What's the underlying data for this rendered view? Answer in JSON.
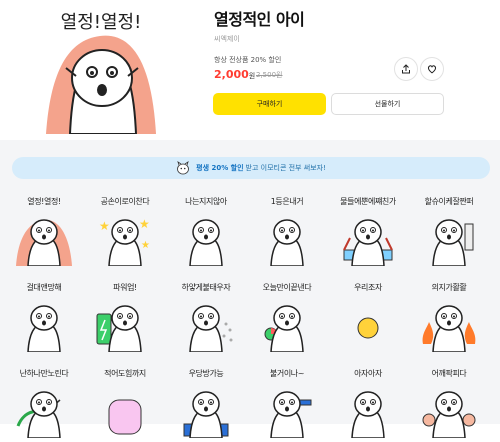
{
  "product": {
    "title": "열정적인 아이",
    "author": "씨엑제이",
    "promo": "항상 전상품 20% 할인",
    "price": "2,000",
    "currency": "원",
    "original_price": "2,500원",
    "thumb_text": "열정!열정!",
    "buy_label": "구매하기",
    "gift_label": "선물하기"
  },
  "banner": {
    "strong": "평생 20% 할인",
    "text": "받고 이모티콘 전부 써보자!"
  },
  "stickers": [
    {
      "caption": "열정!열정!"
    },
    {
      "caption": "공손이로이찬다"
    },
    {
      "caption": "나는지지않아"
    },
    {
      "caption": "1등은내거"
    },
    {
      "caption": "물들에뿐에쨰친가"
    },
    {
      "caption": "할슈이케잘쨘퍼"
    },
    {
      "caption": "걸대앤망해"
    },
    {
      "caption": "파워업!"
    },
    {
      "caption": "하얗게불태우자"
    },
    {
      "caption": "오늘만이끝낸다"
    },
    {
      "caption": "우리조자"
    },
    {
      "caption": "의지가활활"
    },
    {
      "caption": "난하나만노린다"
    },
    {
      "caption": "적어도힘까지"
    },
    {
      "caption": "우당방가능"
    },
    {
      "caption": "불거이나~"
    },
    {
      "caption": "아자아자"
    },
    {
      "caption": "어깨팍피다"
    }
  ],
  "icons": {
    "share": "share-icon",
    "like": "heart-icon",
    "banner": "mascot-icon"
  },
  "colors": {
    "accent": "#ffe100",
    "price": "#ff3b30",
    "banner": "#d6ecfb"
  }
}
